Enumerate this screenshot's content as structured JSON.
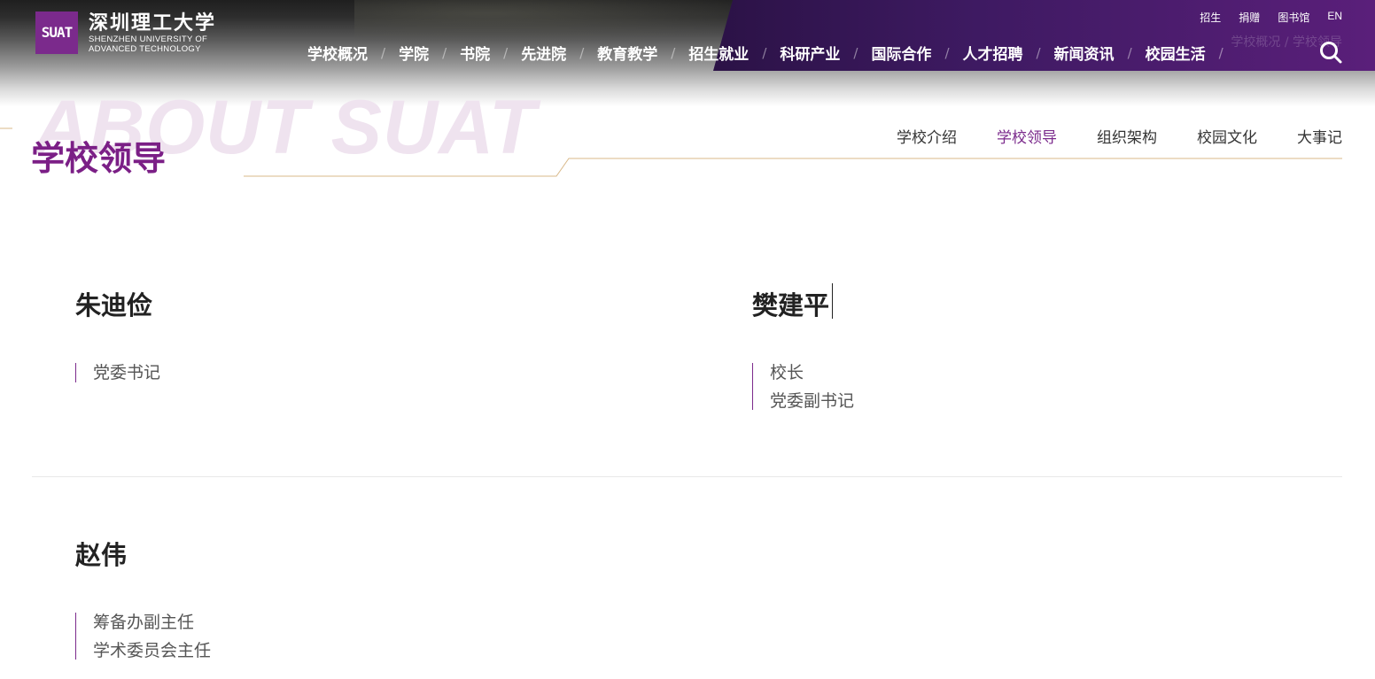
{
  "logo": {
    "mark": "SUAT",
    "name_cn": "深圳理工大学",
    "name_en_line1": "SHENZHEN UNIVERSITY OF",
    "name_en_line2": "ADVANCED TECHNOLOGY"
  },
  "utility_links": [
    "招生",
    "捐赠",
    "图书馆",
    "EN"
  ],
  "nav": {
    "items": [
      "学校概况",
      "学院",
      "书院",
      "先进院",
      "教育教学",
      "招生就业",
      "科研产业",
      "国际合作",
      "人才招聘",
      "新闻资讯",
      "校园生活"
    ],
    "separator": "/"
  },
  "breadcrumb": "学校概况 / 学校领导",
  "page": {
    "bg_word": "ABOUT SUAT",
    "title": "学校领导"
  },
  "subnav": {
    "items": [
      "学校介绍",
      "学校领导",
      "组织架构",
      "校园文化",
      "大事记"
    ],
    "active": "学校领导"
  },
  "leaders": [
    {
      "name": "朱迪俭",
      "roles": [
        "党委书记"
      ]
    },
    {
      "name": "樊建平",
      "roles": [
        "校长",
        "党委副书记"
      ]
    },
    {
      "name": "赵伟",
      "roles": [
        "筹备办副主任",
        "学术委员会主任"
      ]
    }
  ],
  "colors": {
    "accent": "#7b2a8c",
    "gold_line": "#d9b98a",
    "nav_band": "#3e1a62"
  },
  "icons": {
    "search": "search-icon"
  }
}
